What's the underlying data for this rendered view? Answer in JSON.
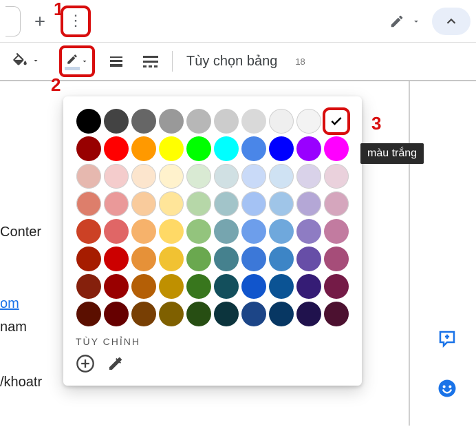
{
  "callouts": {
    "c1": "1",
    "c2": "2",
    "c3": "3"
  },
  "toolbar": {
    "table_options_label": "Tùy chọn bảng",
    "ruler_value": "18"
  },
  "tooltip": {
    "white": "màu trắng"
  },
  "palette": {
    "custom_label": "TÙY CHỈNH",
    "rows": [
      [
        "#000000",
        "#434343",
        "#666666",
        "#999999",
        "#b7b7b7",
        "#cccccc",
        "#d9d9d9",
        "#efefef",
        "#f3f3f3",
        "#ffffff"
      ],
      [
        "#980000",
        "#ff0000",
        "#ff9900",
        "#ffff00",
        "#00ff00",
        "#00ffff",
        "#4a86e8",
        "#0000ff",
        "#9900ff",
        "#ff00ff"
      ],
      [
        "#e6b8af",
        "#f4cccc",
        "#fce5cd",
        "#fff2cc",
        "#d9ead3",
        "#d0e0e3",
        "#c9daf8",
        "#cfe2f3",
        "#d9d2e9",
        "#ead1dc"
      ],
      [
        "#dd7e6b",
        "#ea9999",
        "#f9cb9c",
        "#ffe599",
        "#b6d7a8",
        "#a2c4c9",
        "#a4c2f4",
        "#9fc5e8",
        "#b4a7d6",
        "#d5a6bd"
      ],
      [
        "#cc4125",
        "#e06666",
        "#f6b26b",
        "#ffd966",
        "#93c47d",
        "#76a5af",
        "#6d9eeb",
        "#6fa8dc",
        "#8e7cc3",
        "#c27ba0"
      ],
      [
        "#a61c00",
        "#cc0000",
        "#e69138",
        "#f1c232",
        "#6aa84f",
        "#45818e",
        "#3c78d8",
        "#3d85c6",
        "#674ea7",
        "#a64d79"
      ],
      [
        "#85200c",
        "#990000",
        "#b45f06",
        "#bf9000",
        "#38761d",
        "#134f5c",
        "#1155cc",
        "#0b5394",
        "#351c75",
        "#741b47"
      ],
      [
        "#5b0f00",
        "#660000",
        "#783f04",
        "#7f6000",
        "#274e13",
        "#0c343d",
        "#1c4587",
        "#073763",
        "#20124d",
        "#4c1130"
      ]
    ],
    "selected_index": [
      0,
      9
    ]
  },
  "doc_text": {
    "l1": "Conter",
    "l2": "om",
    "l3": "nam",
    "l4": "/khoatr"
  }
}
